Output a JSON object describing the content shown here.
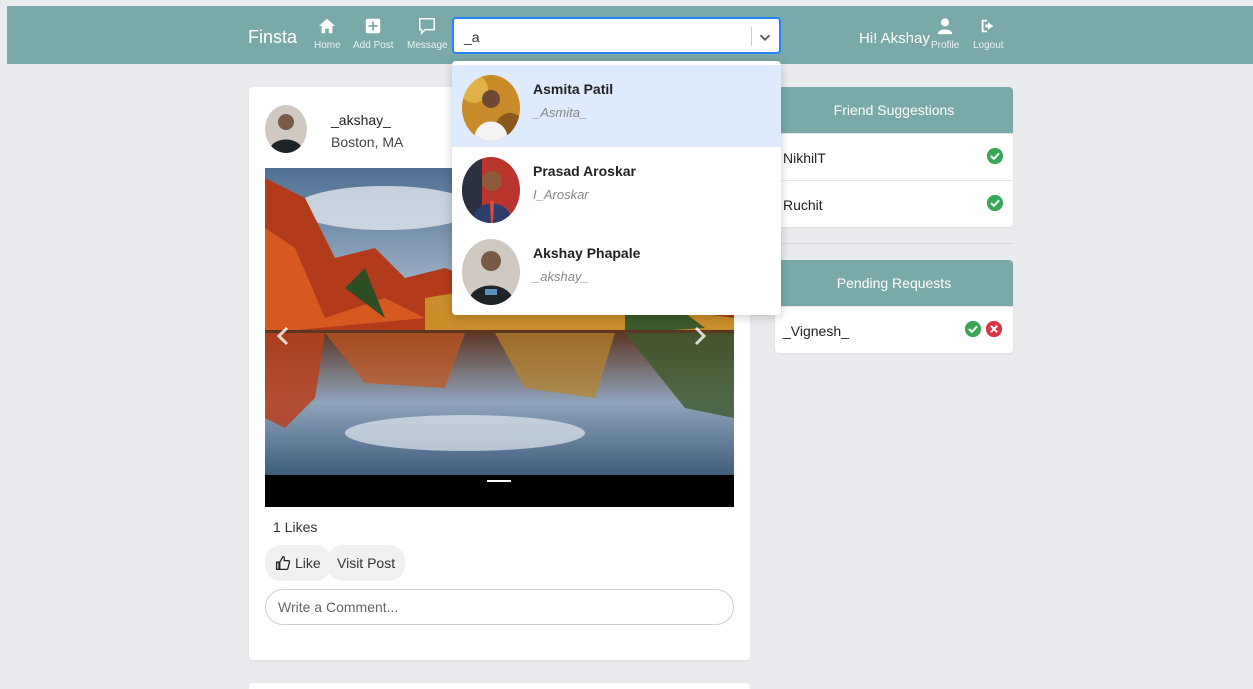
{
  "nav": {
    "brand": "Finsta",
    "home_label": "Home",
    "add_post_label": "Add Post",
    "message_label": "Message",
    "greeting": "Hi! Akshay",
    "profile_label": "Profile",
    "logout_label": "Logout"
  },
  "search": {
    "value": "_a"
  },
  "search_results": [
    {
      "name": "Asmita Patil",
      "username": "_Asmita_"
    },
    {
      "name": "Prasad Aroskar",
      "username": "I_Aroskar"
    },
    {
      "name": "Akshay Phapale",
      "username": "_akshay_"
    }
  ],
  "post": {
    "username": "_akshay_",
    "location": "Boston, MA",
    "likes": "1 Likes",
    "like_label": "Like",
    "visit_label": "Visit Post",
    "comment_placeholder": "Write a Comment..."
  },
  "suggestions": {
    "title": "Friend Suggestions",
    "items": [
      "NikhilT",
      "Ruchit"
    ]
  },
  "pending": {
    "title": "Pending Requests",
    "items": [
      "_Vignesh_"
    ]
  },
  "colors": {
    "navbar": "#7aa9a9",
    "accept": "#3aa757",
    "reject": "#dc3545",
    "selected_option": "#deebff"
  }
}
